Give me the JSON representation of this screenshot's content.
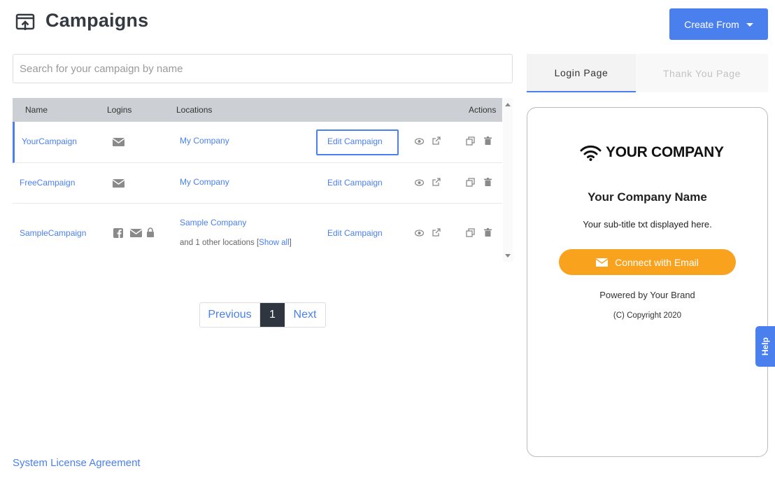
{
  "header": {
    "title": "Campaigns",
    "create_label": "Create From"
  },
  "search": {
    "placeholder": "Search for your campaign by name"
  },
  "table": {
    "columns": [
      "Name",
      "Logins",
      "Locations",
      "Actions"
    ],
    "rows": [
      {
        "name": "YourCampaign",
        "logins": [
          "email-icon"
        ],
        "location": "My Company",
        "extra": "",
        "show_all": "",
        "edit": "Edit Campaign"
      },
      {
        "name": "FreeCampaign",
        "logins": [
          "email-icon"
        ],
        "location": "My Company",
        "extra": "",
        "show_all": "",
        "edit": "Edit Campaign"
      },
      {
        "name": "SampleCampaign",
        "logins": [
          "facebook-icon",
          "email-icon",
          "lock-icon"
        ],
        "location": "Sample Company",
        "extra": "and 1 other locations",
        "show_all": "Show all",
        "edit": "Edit Campaign"
      }
    ]
  },
  "pagination": {
    "previous": "Previous",
    "current": "1",
    "next": "Next"
  },
  "footer": {
    "license": "System License Agreement"
  },
  "preview": {
    "tabs": [
      "Login Page",
      "Thank You Page"
    ],
    "logo_text": "YOUR COMPANY",
    "company_name": "Your Company Name",
    "subtitle": "Your sub-title txt displayed here.",
    "connect_label": "Connect with Email",
    "powered_by": "Powered by Your Brand",
    "copyright": "(C) Copyright 2020"
  },
  "help": {
    "label": "Help"
  },
  "colors": {
    "accent": "#4a80ee",
    "connect": "#f8a21d",
    "table_header": "#ccd0d5"
  }
}
